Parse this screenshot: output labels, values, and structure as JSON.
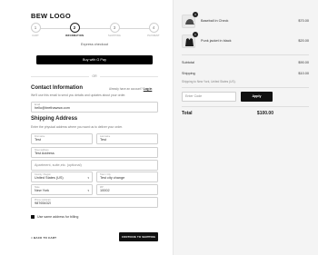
{
  "brand": {
    "logo_text": "BEW LOGO"
  },
  "steps": [
    {
      "number": "1",
      "label": "Cart"
    },
    {
      "number": "2",
      "label": "Information"
    },
    {
      "number": "3",
      "label": "Shipping"
    },
    {
      "number": "4",
      "label": "Payment"
    }
  ],
  "express": {
    "title": "Express checkout",
    "gpay_label": "Buy with G Pay",
    "or_label": "OR"
  },
  "contact": {
    "heading": "Contact Information",
    "account_prompt": "Already have an account?",
    "login_link": "Log in",
    "note": "We'll use this email to send you details and updates about your order.",
    "email_label": "Email",
    "email_value": "hello@brethawww.com"
  },
  "shipping": {
    "heading": "Shipping Address",
    "note": "Enter the physical address where you want us to deliver your order.",
    "first_name_label": "First name",
    "first_name_value": "Test",
    "last_name_label": "Last name",
    "last_name_value": "Test",
    "address_label": "Street address",
    "address_value": "Test Address",
    "apartment_placeholder": "Apartment, suite,etc. (optional)",
    "country_label": "Country / Region",
    "country_value": "United States (US)",
    "city_label": "Town / City",
    "city_value": "Test city change",
    "state_label": "State",
    "state_value": "New York",
    "zip_label": "ZIP",
    "zip_value": "10002",
    "phone_label": "Phone (optional)",
    "phone_value": "98765432l"
  },
  "billing": {
    "same_address_label": "Use same address for billing"
  },
  "footer": {
    "back_label": "< BACK TO CART",
    "continue_label": "CONTINUE TO SHIPPING"
  },
  "order": {
    "items": [
      {
        "name": "Baseball in Check",
        "price": "$70.00",
        "qty": "3",
        "icon": "cap-icon"
      },
      {
        "name": "Punk jacket in black",
        "price": "$20.00",
        "qty": "1",
        "icon": "jacket-icon"
      }
    ],
    "subtotal_label": "Subtotal",
    "subtotal_value": "$90.00",
    "shipping_label": "Shipping",
    "shipping_value": "$10.00",
    "shipping_note": "Shipping to New York, United States (US).",
    "promo_placeholder": "Enter Code",
    "apply_label": "Apply",
    "total_label": "Total",
    "total_value": "$100.00"
  },
  "colors": {
    "accent": "#111111",
    "sidebar_bg": "#f4f4f4",
    "border": "#cfcfcf"
  }
}
